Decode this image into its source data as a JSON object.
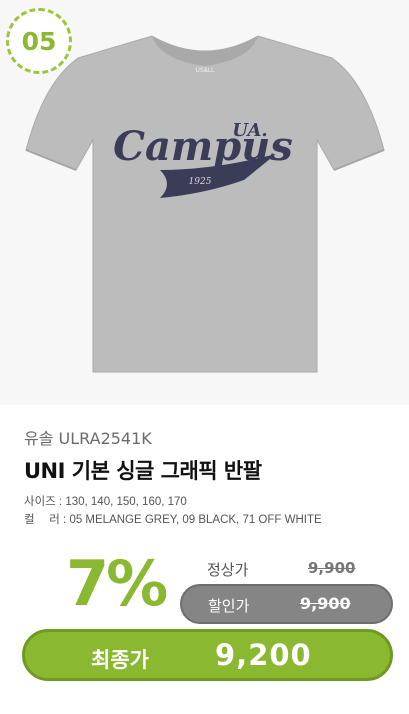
{
  "badge": {
    "number": "05",
    "color": "#8ab831"
  },
  "product": {
    "image_text": {
      "brand": "UA.",
      "graphic": "Campus",
      "year": "1925",
      "tag": "US&LL"
    },
    "code": "유솔 ULRA2541K",
    "name": "UNI 기본 싱글 그래픽 반팔",
    "sizes": "사이즈 : 130, 140, 150, 160, 170",
    "colors": "컬　 러 : 05 MELANGE GREY, 09 BLACK, 71 OFF WHITE"
  },
  "pricing": {
    "discount": "7%",
    "regular_label": "정상가",
    "regular_price": "9,900",
    "sale_label": "할인가",
    "sale_price": "9,900",
    "final_label": "최종가",
    "final_price": "9,200"
  },
  "colors": {
    "accent": "#8ab831",
    "shirt": "#b9b9b9",
    "graphic": "#3a3c58"
  }
}
